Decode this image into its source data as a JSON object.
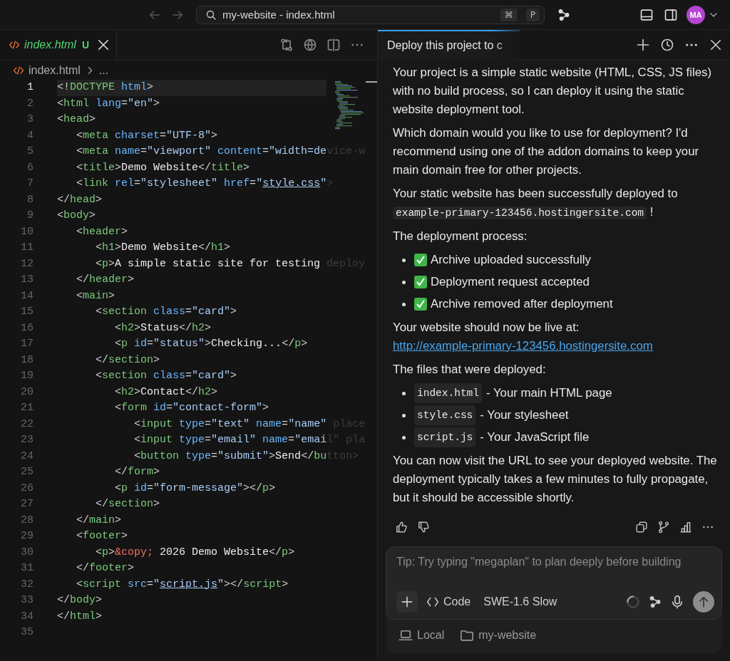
{
  "title_bar": {
    "search": "my-website - index.html",
    "shortcut_keys": [
      "⌘",
      "P"
    ],
    "avatar": "MA"
  },
  "editor": {
    "tab": {
      "filename": "index.html",
      "status": "U",
      "selected": true
    },
    "breadcrumb": [
      "index.html",
      "..."
    ],
    "lines": [
      {
        "number": "1",
        "selected": true,
        "tokens": [
          {
            "kind": "p",
            "text": "<!"
          },
          {
            "kind": "tag",
            "text": "DOCTYPE"
          },
          {
            "kind": "attr",
            "text": " html"
          },
          {
            "kind": "p",
            "text": ">"
          }
        ]
      },
      {
        "number": "2",
        "selected": false,
        "tokens": [
          {
            "kind": "p",
            "text": "<"
          },
          {
            "kind": "tag",
            "text": "html"
          },
          {
            "kind": "attr",
            "text": " lang"
          },
          {
            "kind": "p",
            "text": "="
          },
          {
            "kind": "str",
            "text": "\"en\""
          },
          {
            "kind": "p",
            "text": ">"
          }
        ]
      },
      {
        "number": "3",
        "selected": false,
        "tokens": [
          {
            "kind": "p",
            "text": "<"
          },
          {
            "kind": "tag",
            "text": "head"
          },
          {
            "kind": "p",
            "text": ">"
          }
        ]
      },
      {
        "number": "4",
        "selected": false,
        "tokens": [
          {
            "kind": "p",
            "text": "   <"
          },
          {
            "kind": "tag",
            "text": "meta"
          },
          {
            "kind": "attr",
            "text": " charset"
          },
          {
            "kind": "p",
            "text": "="
          },
          {
            "kind": "str",
            "text": "\"UTF-8\""
          },
          {
            "kind": "p",
            "text": ">"
          }
        ]
      },
      {
        "number": "5",
        "selected": false,
        "tokens": [
          {
            "kind": "p",
            "text": "   <"
          },
          {
            "kind": "tag",
            "text": "meta"
          },
          {
            "kind": "attr",
            "text": " name"
          },
          {
            "kind": "p",
            "text": "="
          },
          {
            "kind": "str",
            "text": "\"viewport\""
          },
          {
            "kind": "attr",
            "text": " content"
          },
          {
            "kind": "p",
            "text": "="
          },
          {
            "kind": "str",
            "text": "\"width=de"
          },
          {
            "kind": "fade",
            "text": "vice-w"
          }
        ]
      },
      {
        "number": "6",
        "selected": false,
        "tokens": [
          {
            "kind": "p",
            "text": "   <"
          },
          {
            "kind": "tag",
            "text": "title"
          },
          {
            "kind": "p",
            "text": ">"
          },
          {
            "kind": "text",
            "text": "Demo Website"
          },
          {
            "kind": "p",
            "text": "</"
          },
          {
            "kind": "tag",
            "text": "title"
          },
          {
            "kind": "p",
            "text": ">"
          }
        ]
      },
      {
        "number": "7",
        "selected": false,
        "tokens": [
          {
            "kind": "p",
            "text": "   <"
          },
          {
            "kind": "tag",
            "text": "link"
          },
          {
            "kind": "attr",
            "text": " rel"
          },
          {
            "kind": "p",
            "text": "="
          },
          {
            "kind": "str",
            "text": "\"stylesheet\""
          },
          {
            "kind": "attr",
            "text": " href"
          },
          {
            "kind": "p",
            "text": "="
          },
          {
            "kind": "str",
            "text": "\""
          },
          {
            "kind": "link",
            "text": "style.css"
          },
          {
            "kind": "str",
            "text": "\""
          },
          {
            "kind": "fade",
            "text": ">"
          }
        ]
      },
      {
        "number": "8",
        "selected": false,
        "tokens": [
          {
            "kind": "p",
            "text": "</"
          },
          {
            "kind": "tag",
            "text": "head"
          },
          {
            "kind": "p",
            "text": ">"
          }
        ]
      },
      {
        "number": "9",
        "selected": false,
        "tokens": [
          {
            "kind": "p",
            "text": "<"
          },
          {
            "kind": "tag",
            "text": "body"
          },
          {
            "kind": "p",
            "text": ">"
          }
        ]
      },
      {
        "number": "10",
        "selected": false,
        "tokens": [
          {
            "kind": "p",
            "text": "   <"
          },
          {
            "kind": "tag",
            "text": "header"
          },
          {
            "kind": "p",
            "text": ">"
          }
        ]
      },
      {
        "number": "11",
        "selected": false,
        "tokens": [
          {
            "kind": "p",
            "text": "      <"
          },
          {
            "kind": "tag",
            "text": "h1"
          },
          {
            "kind": "p",
            "text": ">"
          },
          {
            "kind": "text",
            "text": "Demo Website"
          },
          {
            "kind": "p",
            "text": "</"
          },
          {
            "kind": "tag",
            "text": "h1"
          },
          {
            "kind": "p",
            "text": ">"
          }
        ]
      },
      {
        "number": "12",
        "selected": false,
        "tokens": [
          {
            "kind": "p",
            "text": "      <"
          },
          {
            "kind": "tag",
            "text": "p"
          },
          {
            "kind": "p",
            "text": ">"
          },
          {
            "kind": "text",
            "text": "A simple static site for testing"
          },
          {
            "kind": "fade",
            "text": " deploy"
          }
        ]
      },
      {
        "number": "13",
        "selected": false,
        "tokens": [
          {
            "kind": "p",
            "text": "   </"
          },
          {
            "kind": "tag",
            "text": "header"
          },
          {
            "kind": "p",
            "text": ">"
          }
        ]
      },
      {
        "number": "14",
        "selected": false,
        "tokens": [
          {
            "kind": "p",
            "text": "   <"
          },
          {
            "kind": "tag",
            "text": "main"
          },
          {
            "kind": "p",
            "text": ">"
          }
        ]
      },
      {
        "number": "15",
        "selected": false,
        "tokens": [
          {
            "kind": "p",
            "text": "      <"
          },
          {
            "kind": "tag",
            "text": "section"
          },
          {
            "kind": "attr",
            "text": " class"
          },
          {
            "kind": "p",
            "text": "="
          },
          {
            "kind": "str",
            "text": "\"card\""
          },
          {
            "kind": "p",
            "text": ">"
          }
        ]
      },
      {
        "number": "16",
        "selected": false,
        "tokens": [
          {
            "kind": "p",
            "text": "         <"
          },
          {
            "kind": "tag",
            "text": "h2"
          },
          {
            "kind": "p",
            "text": ">"
          },
          {
            "kind": "text",
            "text": "Status"
          },
          {
            "kind": "p",
            "text": "</"
          },
          {
            "kind": "tag",
            "text": "h2"
          },
          {
            "kind": "p",
            "text": ">"
          }
        ]
      },
      {
        "number": "17",
        "selected": false,
        "tokens": [
          {
            "kind": "p",
            "text": "         <"
          },
          {
            "kind": "tag",
            "text": "p"
          },
          {
            "kind": "attr",
            "text": " id"
          },
          {
            "kind": "p",
            "text": "="
          },
          {
            "kind": "str",
            "text": "\"status\""
          },
          {
            "kind": "p",
            "text": ">"
          },
          {
            "kind": "text",
            "text": "Checking..."
          },
          {
            "kind": "p",
            "text": "</"
          },
          {
            "kind": "tag",
            "text": "p"
          },
          {
            "kind": "p",
            "text": ">"
          }
        ]
      },
      {
        "number": "18",
        "selected": false,
        "tokens": [
          {
            "kind": "p",
            "text": "      </"
          },
          {
            "kind": "tag",
            "text": "section"
          },
          {
            "kind": "p",
            "text": ">"
          }
        ]
      },
      {
        "number": "19",
        "selected": false,
        "tokens": [
          {
            "kind": "p",
            "text": "      <"
          },
          {
            "kind": "tag",
            "text": "section"
          },
          {
            "kind": "attr",
            "text": " class"
          },
          {
            "kind": "p",
            "text": "="
          },
          {
            "kind": "str",
            "text": "\"card\""
          },
          {
            "kind": "p",
            "text": ">"
          }
        ]
      },
      {
        "number": "20",
        "selected": false,
        "tokens": [
          {
            "kind": "p",
            "text": "         <"
          },
          {
            "kind": "tag",
            "text": "h2"
          },
          {
            "kind": "p",
            "text": ">"
          },
          {
            "kind": "text",
            "text": "Contact"
          },
          {
            "kind": "p",
            "text": "</"
          },
          {
            "kind": "tag",
            "text": "h2"
          },
          {
            "kind": "p",
            "text": ">"
          }
        ]
      },
      {
        "number": "21",
        "selected": false,
        "tokens": [
          {
            "kind": "p",
            "text": "         <"
          },
          {
            "kind": "tag",
            "text": "form"
          },
          {
            "kind": "attr",
            "text": " id"
          },
          {
            "kind": "p",
            "text": "="
          },
          {
            "kind": "str",
            "text": "\"contact-form\""
          },
          {
            "kind": "p",
            "text": ">"
          }
        ]
      },
      {
        "number": "22",
        "selected": false,
        "tokens": [
          {
            "kind": "p",
            "text": "            <"
          },
          {
            "kind": "tag",
            "text": "input"
          },
          {
            "kind": "attr",
            "text": " type"
          },
          {
            "kind": "p",
            "text": "="
          },
          {
            "kind": "str",
            "text": "\"text\""
          },
          {
            "kind": "attr",
            "text": " name"
          },
          {
            "kind": "p",
            "text": "="
          },
          {
            "kind": "str",
            "text": "\"name\""
          },
          {
            "kind": "fade",
            "text": " place"
          }
        ]
      },
      {
        "number": "23",
        "selected": false,
        "tokens": [
          {
            "kind": "p",
            "text": "            <"
          },
          {
            "kind": "tag",
            "text": "input"
          },
          {
            "kind": "attr",
            "text": " type"
          },
          {
            "kind": "p",
            "text": "="
          },
          {
            "kind": "str",
            "text": "\"email\""
          },
          {
            "kind": "attr",
            "text": " name"
          },
          {
            "kind": "p",
            "text": "="
          },
          {
            "kind": "str",
            "text": "\"emai"
          },
          {
            "kind": "fade",
            "text": "l\" pla"
          }
        ]
      },
      {
        "number": "24",
        "selected": false,
        "tokens": [
          {
            "kind": "p",
            "text": "            <"
          },
          {
            "kind": "tag",
            "text": "button"
          },
          {
            "kind": "attr",
            "text": " type"
          },
          {
            "kind": "p",
            "text": "="
          },
          {
            "kind": "str",
            "text": "\"submit\""
          },
          {
            "kind": "p",
            "text": ">"
          },
          {
            "kind": "text",
            "text": "Send"
          },
          {
            "kind": "p",
            "text": "</"
          },
          {
            "kind": "tag",
            "text": "bu"
          },
          {
            "kind": "fade",
            "text": "tton>"
          }
        ]
      },
      {
        "number": "25",
        "selected": false,
        "tokens": [
          {
            "kind": "p",
            "text": "         </"
          },
          {
            "kind": "tag",
            "text": "form"
          },
          {
            "kind": "p",
            "text": ">"
          }
        ]
      },
      {
        "number": "26",
        "selected": false,
        "tokens": [
          {
            "kind": "p",
            "text": "         <"
          },
          {
            "kind": "tag",
            "text": "p"
          },
          {
            "kind": "attr",
            "text": " id"
          },
          {
            "kind": "p",
            "text": "="
          },
          {
            "kind": "str",
            "text": "\"form-message\""
          },
          {
            "kind": "p",
            "text": "></"
          },
          {
            "kind": "tag",
            "text": "p"
          },
          {
            "kind": "p",
            "text": ">"
          }
        ]
      },
      {
        "number": "27",
        "selected": false,
        "tokens": [
          {
            "kind": "p",
            "text": "      </"
          },
          {
            "kind": "tag",
            "text": "section"
          },
          {
            "kind": "p",
            "text": ">"
          }
        ]
      },
      {
        "number": "28",
        "selected": false,
        "tokens": [
          {
            "kind": "p",
            "text": "   </"
          },
          {
            "kind": "tag",
            "text": "main"
          },
          {
            "kind": "p",
            "text": ">"
          }
        ]
      },
      {
        "number": "29",
        "selected": false,
        "tokens": [
          {
            "kind": "p",
            "text": "   <"
          },
          {
            "kind": "tag",
            "text": "footer"
          },
          {
            "kind": "p",
            "text": ">"
          }
        ]
      },
      {
        "number": "30",
        "selected": false,
        "tokens": [
          {
            "kind": "p",
            "text": "      <"
          },
          {
            "kind": "tag",
            "text": "p"
          },
          {
            "kind": "p",
            "text": ">"
          },
          {
            "kind": "ent",
            "text": "&copy;"
          },
          {
            "kind": "text",
            "text": " 2026 Demo Website"
          },
          {
            "kind": "p",
            "text": "</"
          },
          {
            "kind": "tag",
            "text": "p"
          },
          {
            "kind": "p",
            "text": ">"
          }
        ]
      },
      {
        "number": "31",
        "selected": false,
        "tokens": [
          {
            "kind": "p",
            "text": "   </"
          },
          {
            "kind": "tag",
            "text": "footer"
          },
          {
            "kind": "p",
            "text": ">"
          }
        ]
      },
      {
        "number": "32",
        "selected": false,
        "tokens": [
          {
            "kind": "p",
            "text": "   <"
          },
          {
            "kind": "tag",
            "text": "script"
          },
          {
            "kind": "attr",
            "text": " src"
          },
          {
            "kind": "p",
            "text": "="
          },
          {
            "kind": "str",
            "text": "\""
          },
          {
            "kind": "link",
            "text": "script.js"
          },
          {
            "kind": "str",
            "text": "\""
          },
          {
            "kind": "p",
            "text": "></"
          },
          {
            "kind": "tag",
            "text": "script"
          },
          {
            "kind": "p",
            "text": ">"
          }
        ]
      },
      {
        "number": "33",
        "selected": false,
        "tokens": [
          {
            "kind": "p",
            "text": "</"
          },
          {
            "kind": "tag",
            "text": "body"
          },
          {
            "kind": "p",
            "text": ">"
          }
        ]
      },
      {
        "number": "34",
        "selected": false,
        "tokens": [
          {
            "kind": "p",
            "text": "</"
          },
          {
            "kind": "tag",
            "text": "html"
          },
          {
            "kind": "p",
            "text": ">"
          }
        ]
      },
      {
        "number": "35",
        "selected": false
      }
    ]
  },
  "chat": {
    "tab": {
      "title": "Deploy this project to c",
      "selected": true
    },
    "blocks": [
      {
        "kind": "paragraph",
        "parts": [
          {
            "kind": "text",
            "text": "Your project is a simple static website (HTML, CSS, JS files) with no build process, so I can deploy it using the static website deployment tool."
          }
        ]
      },
      {
        "kind": "paragraph",
        "parts": [
          {
            "kind": "text",
            "text": "Which domain would you like to use for deployment? I'd recommend using one of the addon domains to keep your main domain free for other projects."
          }
        ]
      },
      {
        "kind": "paragraph",
        "parts": [
          {
            "kind": "text",
            "text": "Your static website has been successfully deployed to"
          },
          {
            "kind": "code",
            "text": "example-primary-123456.hostingersite.com"
          },
          {
            "kind": "text",
            "text": "!"
          }
        ]
      },
      {
        "kind": "paragraph",
        "parts": [
          {
            "kind": "text",
            "text": "The deployment process:"
          }
        ]
      },
      {
        "kind": "list",
        "items": [
          {
            "kind": "done",
            "parts": [
              {
                "kind": "text",
                "text": "Archive uploaded successfully"
              }
            ]
          },
          {
            "kind": "done",
            "parts": [
              {
                "kind": "text",
                "text": "Deployment request accepted"
              }
            ]
          },
          {
            "kind": "done",
            "parts": [
              {
                "kind": "text",
                "text": "Archive removed after deployment"
              }
            ]
          }
        ]
      },
      {
        "kind": "paragraph",
        "parts": [
          {
            "kind": "text",
            "text": "Your website should now be live at:"
          },
          {
            "kind": "link",
            "text": "http://example-primary-123456.hostingersite.com"
          }
        ]
      },
      {
        "kind": "paragraph",
        "parts": [
          {
            "kind": "text",
            "text": "The files that were deployed:"
          }
        ]
      },
      {
        "kind": "list",
        "items": [
          {
            "kind": "plain",
            "parts": [
              {
                "kind": "code",
                "text": "index.html"
              },
              {
                "kind": "text",
                "text": "- Your main HTML page"
              }
            ]
          },
          {
            "kind": "plain",
            "parts": [
              {
                "kind": "code",
                "text": "style.css"
              },
              {
                "kind": "text",
                "text": "- Your stylesheet"
              }
            ]
          },
          {
            "kind": "plain",
            "parts": [
              {
                "kind": "code",
                "text": "script.js"
              },
              {
                "kind": "text",
                "text": "- Your JavaScript file"
              }
            ]
          }
        ]
      },
      {
        "kind": "paragraph",
        "parts": [
          {
            "kind": "text",
            "text": "You can now visit the URL to see your deployed website. The deployment typically takes a few minutes to fully propagate, but it should be accessible shortly."
          }
        ]
      }
    ],
    "composer": {
      "placeholder": "Tip: Try typing \"megaplan\" to plan deeply before building",
      "mode": "Code",
      "model": "SWE-1.6 Slow"
    },
    "footer": {
      "location": "Local",
      "folder": "my-website"
    }
  }
}
